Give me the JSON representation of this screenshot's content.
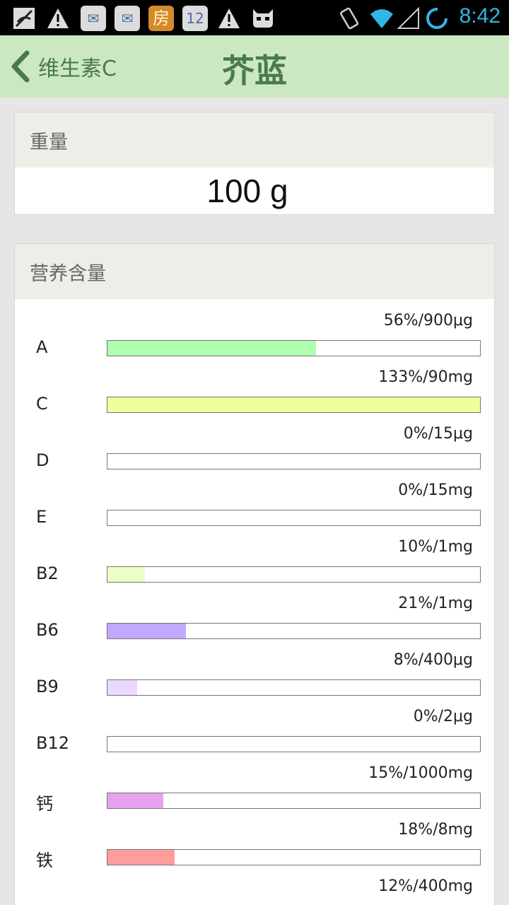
{
  "status_bar": {
    "time": "8:42",
    "fang_label": "房",
    "icons_left": [
      "no-sim-icon",
      "warning-icon",
      "app-store-icon",
      "app-store-icon",
      "fang-app-icon",
      "app-store-12-icon",
      "warning-icon",
      "android-icon"
    ],
    "icons_right": [
      "vibrate-icon",
      "wifi-icon",
      "signal-icon",
      "sync-icon"
    ]
  },
  "header": {
    "back_label": "维生素C",
    "title": "芥蓝",
    "bg_color": "#cce8c2",
    "text_color": "#4a7a4a"
  },
  "weight": {
    "heading": "重量",
    "value": "100 g"
  },
  "nutrition": {
    "heading": "营养含量",
    "items": [
      {
        "name": "A",
        "value_text": "56%/900μg",
        "percent": 56,
        "color": "#b0ffb0"
      },
      {
        "name": "C",
        "value_text": "133%/90mg",
        "percent": 133,
        "color": "#f0ff99"
      },
      {
        "name": "D",
        "value_text": "0%/15μg",
        "percent": 0,
        "color": "#cccccc"
      },
      {
        "name": "E",
        "value_text": "0%/15mg",
        "percent": 0,
        "color": "#cccccc"
      },
      {
        "name": "B2",
        "value_text": "10%/1mg",
        "percent": 10,
        "color": "#eaffc8"
      },
      {
        "name": "B6",
        "value_text": "21%/1mg",
        "percent": 21,
        "color": "#c2a8ff"
      },
      {
        "name": "B9",
        "value_text": "8%/400μg",
        "percent": 8,
        "color": "#ecd8ff"
      },
      {
        "name": "B12",
        "value_text": "0%/2μg",
        "percent": 0,
        "color": "#cccccc"
      },
      {
        "name": "钙",
        "value_text": "15%/1000mg",
        "percent": 15,
        "color": "#e6a2ec"
      },
      {
        "name": "铁",
        "value_text": "18%/8mg",
        "percent": 18,
        "color": "#ff9c9c"
      },
      {
        "name": "",
        "value_text": "12%/400mg",
        "percent": 12,
        "color": "#cccccc"
      }
    ]
  }
}
